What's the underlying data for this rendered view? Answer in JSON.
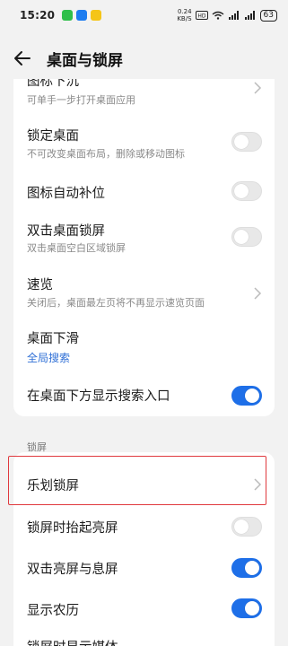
{
  "status_bar": {
    "time": "15:20",
    "net_speed_value": "0.24",
    "net_speed_unit": "KB/S",
    "battery": "63",
    "app_colors": [
      "#2fbf4a",
      "#1c7cf0",
      "#f5c518"
    ]
  },
  "header": {
    "title": "桌面与锁屏",
    "back_icon": "back-arrow-icon"
  },
  "desktop_section": {
    "items": [
      {
        "title": "图标下沉",
        "subtitle": "可单手一步打开桌面应用",
        "control": "chevron"
      },
      {
        "title": "锁定桌面",
        "subtitle": "不可改变桌面布局，删除或移动图标",
        "control": "toggle",
        "on": false
      },
      {
        "title": "图标自动补位",
        "control": "toggle",
        "on": false
      },
      {
        "title": "双击桌面锁屏",
        "subtitle": "双击桌面空白区域锁屏",
        "control": "toggle",
        "on": false
      },
      {
        "title": "速览",
        "subtitle": "关闭后，桌面最左页将不再显示速览页面",
        "control": "chevron"
      },
      {
        "title": "桌面下滑",
        "subtitle": "全局搜索",
        "control": "none"
      },
      {
        "title": "在桌面下方显示搜索入口",
        "control": "toggle",
        "on": true
      }
    ]
  },
  "lock_section": {
    "label": "锁屏",
    "items": [
      {
        "title": "乐划锁屏",
        "control": "chevron"
      },
      {
        "title": "锁屏时抬起亮屏",
        "control": "toggle",
        "on": false
      },
      {
        "title": "双击亮屏与息屏",
        "control": "toggle",
        "on": true
      },
      {
        "title": "显示农历",
        "control": "toggle",
        "on": true
      },
      {
        "title": "锁屏时显示媒体",
        "control": "none"
      }
    ]
  },
  "colors": {
    "accent": "#1e6fe8",
    "highlight": "#e0393e",
    "link": "#2f6fd6"
  }
}
